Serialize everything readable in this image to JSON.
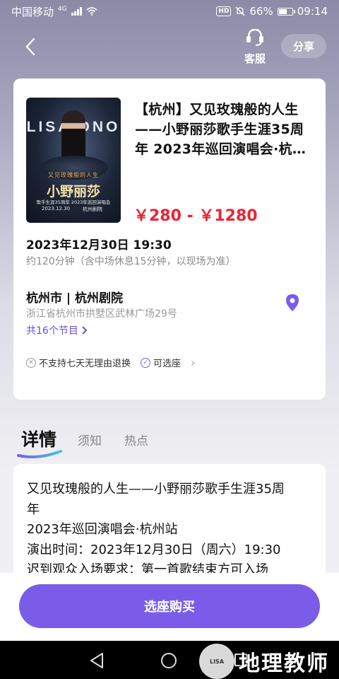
{
  "status_bar": {
    "carrier": "中国移动",
    "network": "4G",
    "hd": "HD",
    "battery_pct": "66%",
    "battery_level": 0.66,
    "time": "09:14"
  },
  "header": {
    "service_label": "客服",
    "share_label": "分享"
  },
  "event": {
    "poster": {
      "name_en": "LISA ONO",
      "subtitle": "又见玫瑰般的人生",
      "name_cn": "小野丽莎",
      "tour": "歌手生涯35周年 2023年巡回演唱会",
      "date": "2023.12.30",
      "venue": "杭州剧院"
    },
    "title_lines": [
      "【杭州】又见玫瑰般的人生",
      "——小野丽莎歌手生涯35周",
      "年 2023年巡回演唱会·杭…"
    ],
    "price": "￥280 - ￥1280",
    "datetime": "2023年12月30日 19:30",
    "duration": "约120分钟（含中场休息15分钟，以现场为准）",
    "venue": "杭州市 | 杭州剧院",
    "address": "浙江省杭州市拱墅区武林广场29号",
    "sessions": "共16个节目",
    "policies": [
      {
        "label": "不支持七天无理由退换",
        "icon": "x-circle-icon"
      },
      {
        "label": "可选座",
        "icon": "check-circle-icon"
      }
    ]
  },
  "tabs": [
    {
      "label": "详情",
      "active": true
    },
    {
      "label": "须知",
      "active": false
    },
    {
      "label": "热点",
      "active": false
    }
  ],
  "detail": {
    "lines": [
      "又见玫瑰般的人生——小野丽莎歌手生涯35周",
      "年",
      "2023年巡回演唱会·杭州站",
      "演出时间：2023年12月30日（周六）19:30",
      "迟到观众入场要求：第一首歌结束方可入场"
    ]
  },
  "action": {
    "buy_label": "选座购买"
  },
  "watermark": {
    "text": "地理教师",
    "badge": "LISA"
  },
  "colors": {
    "accent": "#7b5ce8",
    "price": "#ee2233"
  }
}
